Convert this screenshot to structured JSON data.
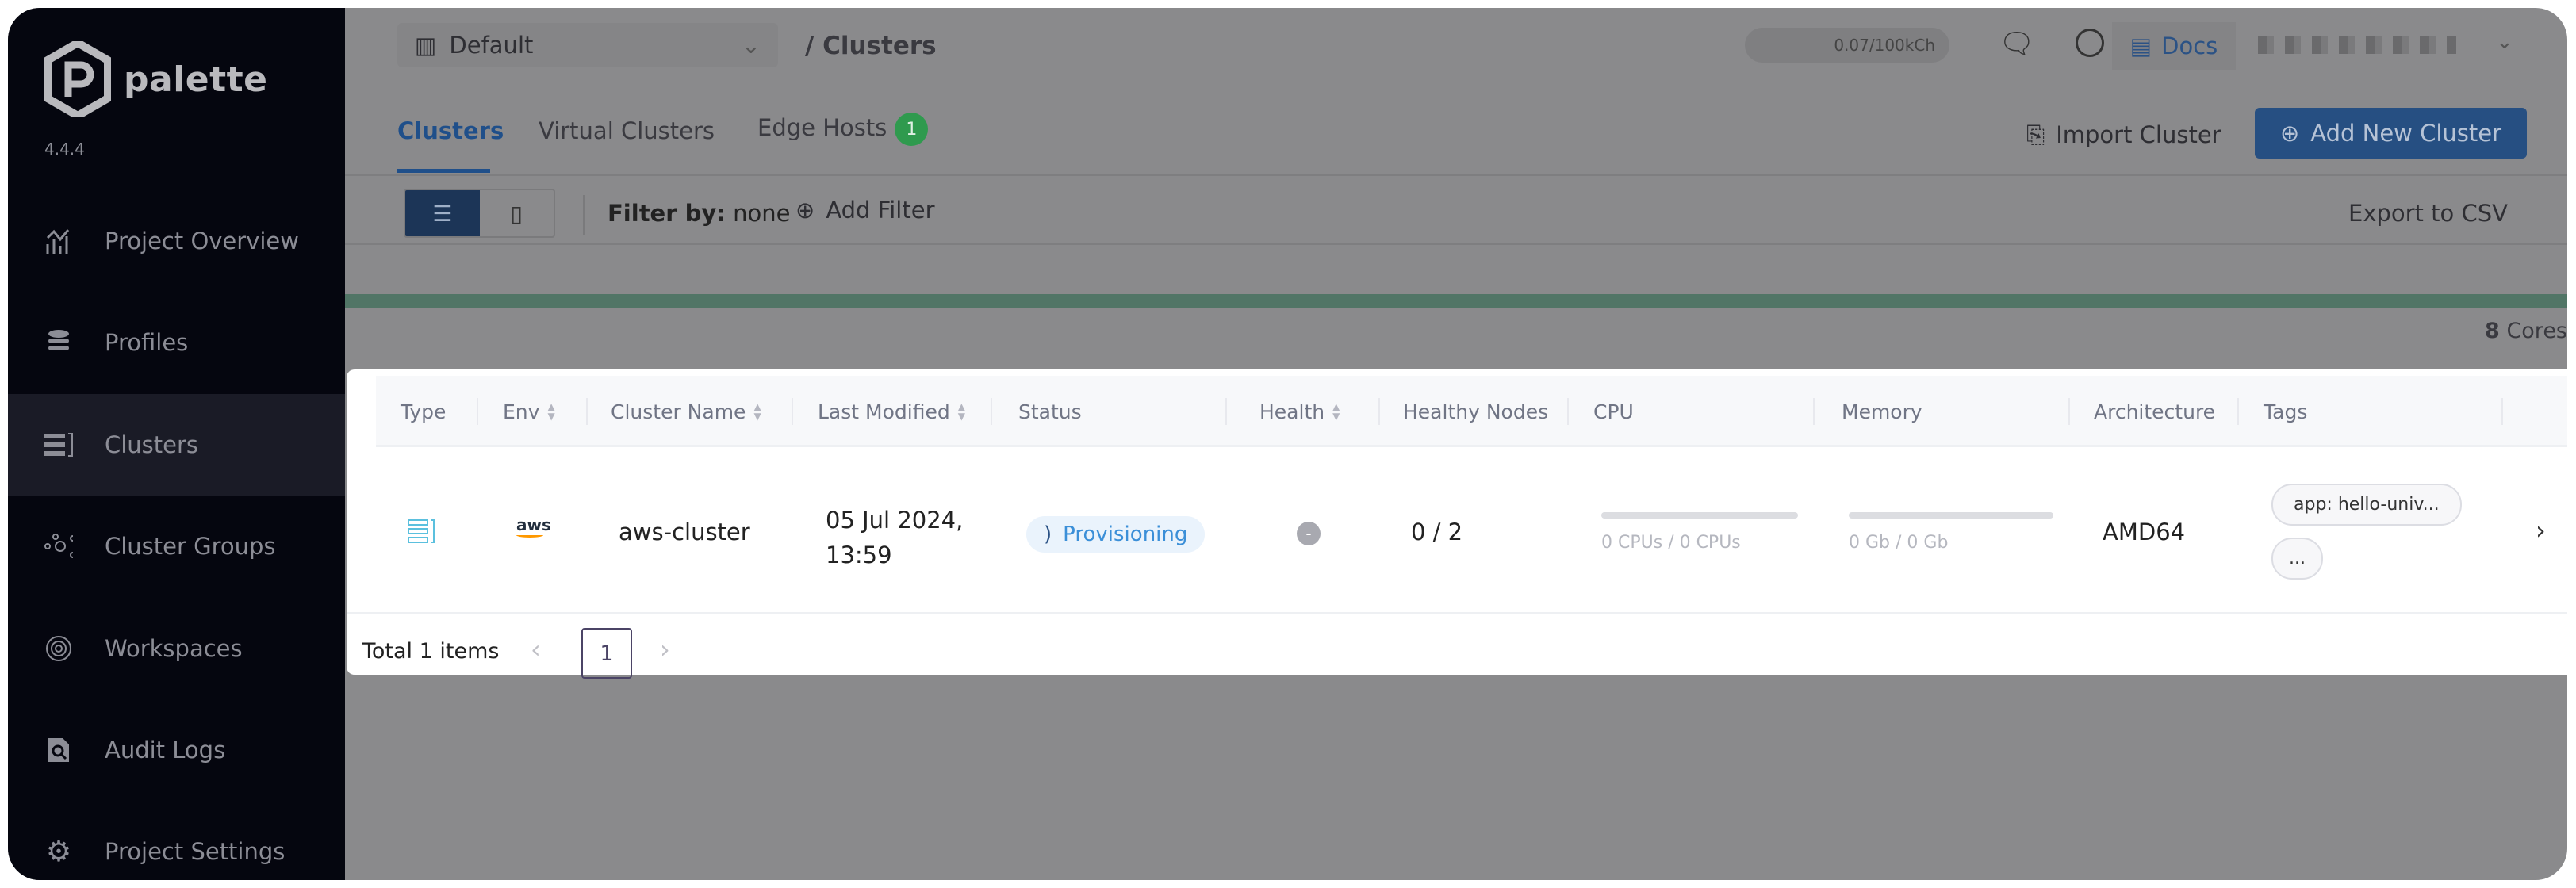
{
  "sidebar": {
    "brand": "palette",
    "version": "4.4.4",
    "items": [
      {
        "label": "Project Overview",
        "icon": "chart-icon",
        "active": false
      },
      {
        "label": "Profiles",
        "icon": "database-icon",
        "active": false
      },
      {
        "label": "Clusters",
        "icon": "clusters-icon",
        "active": true
      },
      {
        "label": "Cluster Groups",
        "icon": "network-icon",
        "active": false
      },
      {
        "label": "Workspaces",
        "icon": "orbit-icon",
        "active": false
      },
      {
        "label": "Audit Logs",
        "icon": "audit-icon",
        "active": false
      },
      {
        "label": "Project Settings",
        "icon": "gear-icon",
        "active": false
      }
    ]
  },
  "header": {
    "project": "Default",
    "breadcrumb": "/ Clusters",
    "usage": "0.07/100kCh",
    "docs": "Docs"
  },
  "tabs": [
    {
      "label": "Clusters",
      "active": true
    },
    {
      "label": "Virtual Clusters"
    },
    {
      "label": "Edge Hosts",
      "badge": "1"
    }
  ],
  "actions": {
    "import": "Import Cluster",
    "add": "Add New Cluster",
    "filter_label": "Filter by:",
    "filter_value": "none",
    "add_filter": "Add Filter",
    "export": "Export to CSV"
  },
  "summary": {
    "cores_value": "8",
    "cores_label": "Cores"
  },
  "colors": {
    "accent": "#1f4f8a",
    "button": "#264f82",
    "status": "#3b8fd8",
    "bar": "#517566"
  },
  "table": {
    "columns": [
      "Type",
      "Env",
      "Cluster Name",
      "Last Modified",
      "Status",
      "Health",
      "Healthy Nodes",
      "CPU",
      "Memory",
      "Architecture",
      "Tags"
    ],
    "rows": [
      {
        "type": "clusters-icon",
        "env": "aws",
        "name": "aws-cluster",
        "date": "05 Jul 2024,",
        "time": "13:59",
        "status": "Provisioning",
        "health": "-",
        "nodes": "0 / 2",
        "cpu": "0 CPUs / 0 CPUs",
        "cpu_fraction": 0,
        "memory": "0 Gb / 0 Gb",
        "memory_fraction": 0,
        "arch": "AMD64",
        "tags": [
          "app: hello-univ...",
          "..."
        ]
      }
    ]
  },
  "pagination": {
    "total": "Total 1 items",
    "page": "1"
  }
}
